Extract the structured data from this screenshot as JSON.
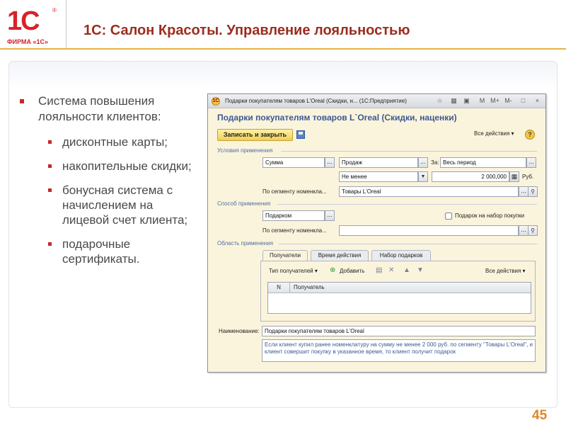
{
  "slide": {
    "logo_main": "1С",
    "logo_reg": "®",
    "logo_firm": "ФИРМА «1С»",
    "title": "1С: Салон Красоты. Управление лояльностью",
    "page_number": "45",
    "accent_color": "#9b2d1f",
    "bullet_color": "#c62828"
  },
  "bullets": {
    "main": "Система повышения лояльности клиентов:",
    "items": [
      "дисконтные карты;",
      "накопительные скидки;",
      "бонусная система с начислением на лицевой счет клиента;",
      "подарочные сертификаты."
    ]
  },
  "window": {
    "titlebar": "Подарки покупателям товаров L'Oreal (Скидки, н...   (1С:Предприятие)",
    "tb_buttons": [
      "☆",
      "▦",
      "▣",
      "M",
      "M+",
      "M-",
      "□",
      "×"
    ],
    "form_title": "Подарки покупателям товаров L`Oreal (Скидки, наценки)",
    "save_close": "Записать и закрыть",
    "all_actions": "Все действия ▾",
    "help": "?",
    "section_conditions": "Условия применения",
    "field_sum": "Сумма",
    "field_sales": "Продаж",
    "label_for": "За:",
    "field_period": "Весь период",
    "field_not_less": "Не менее",
    "field_amount": "2 000,000",
    "label_rub": "Руб.",
    "label_segment": "По сегменту номенкла...",
    "field_segment": "Товары L'Oreal",
    "section_method": "Способ применения",
    "field_method": "Подарком",
    "chk_gift_set": "Подарок на набор покупки",
    "label_segment2": "По сегменту номенкла...",
    "field_segment2": "",
    "section_area": "Область применения",
    "tabs": [
      "Получатели",
      "Время действия",
      "Набор подарков"
    ],
    "recipient_type": "Тип получателей ▾",
    "add": "Добавить",
    "all_actions2": "Все действия ▾",
    "col_n": "N",
    "col_recipient": "Получатель",
    "label_name": "Наименование:",
    "field_name": "Подарки покупателям товаров L'Oreal",
    "note": "Если клиент купил ранее номенклатуру на сумму не менее 2 000 руб. по сегменту \"Товары L'Oreal\", и клиент совершит покупку в указанное время, то клиент получит подарок"
  }
}
